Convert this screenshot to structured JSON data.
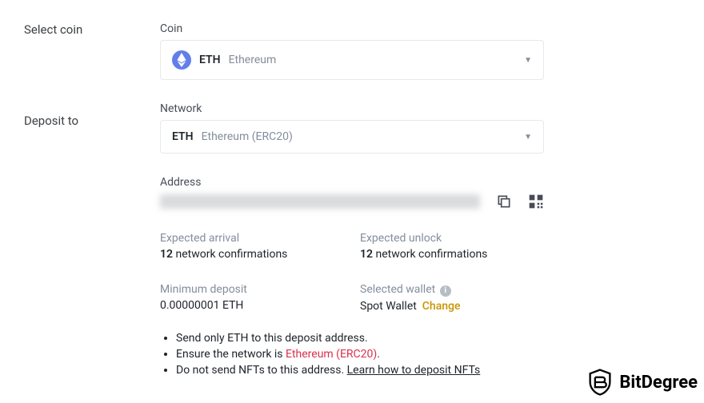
{
  "labels": {
    "select_coin": "Select coin",
    "deposit_to": "Deposit to",
    "coin": "Coin",
    "network": "Network",
    "address": "Address"
  },
  "coin": {
    "symbol": "ETH",
    "name": "Ethereum"
  },
  "network": {
    "symbol": "ETH",
    "name": "Ethereum (ERC20)"
  },
  "info": {
    "expected_arrival_label": "Expected arrival",
    "expected_arrival_count": "12",
    "expected_arrival_unit": "network confirmations",
    "expected_unlock_label": "Expected unlock",
    "expected_unlock_count": "12",
    "expected_unlock_unit": "network confirmations",
    "min_deposit_label": "Minimum deposit",
    "min_deposit_value": "0.00000001 ETH",
    "selected_wallet_label": "Selected wallet",
    "selected_wallet_value": "Spot Wallet",
    "change": "Change"
  },
  "bullets": {
    "b1_pre": "Send only ",
    "b1_sym": "ETH",
    "b1_post": " to this deposit address.",
    "b2_pre": "Ensure the network is ",
    "b2_net": "Ethereum (ERC20)",
    "b2_post": ".",
    "b3_pre": "Do not send NFTs to this address. ",
    "b3_link": "Learn how to deposit NFTs"
  },
  "watermark": "BitDegree"
}
